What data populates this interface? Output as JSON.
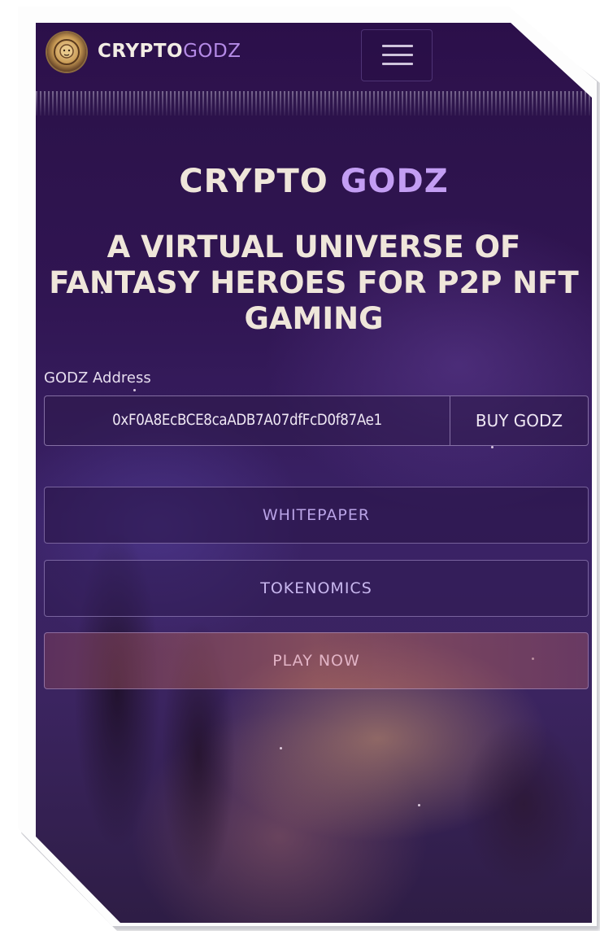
{
  "header": {
    "brand_part1": "CRYPTO",
    "brand_part2": "GODZ",
    "logo_icon": "lion-emblem-icon",
    "menu_icon": "hamburger-menu-icon"
  },
  "hero": {
    "title_part1": "CRYPTO",
    "title_part2": "GODZ",
    "tagline": "A VIRTUAL UNIVERSE OF\nFANTASY HEROES FOR P2P NFT\nGAMING"
  },
  "address": {
    "label": "GODZ Address",
    "value": "0xF0A8EcBCE8caADB7A07dfFcD0f87Ae1",
    "buy_label": "BUY GODZ"
  },
  "actions": {
    "whitepaper": "WHITEPAPER",
    "tokenomics": "TOKENOMICS",
    "play": "PLAY NOW"
  },
  "colors": {
    "background": "#2e1450",
    "accent": "#c39ef3",
    "text": "#efe6da"
  }
}
